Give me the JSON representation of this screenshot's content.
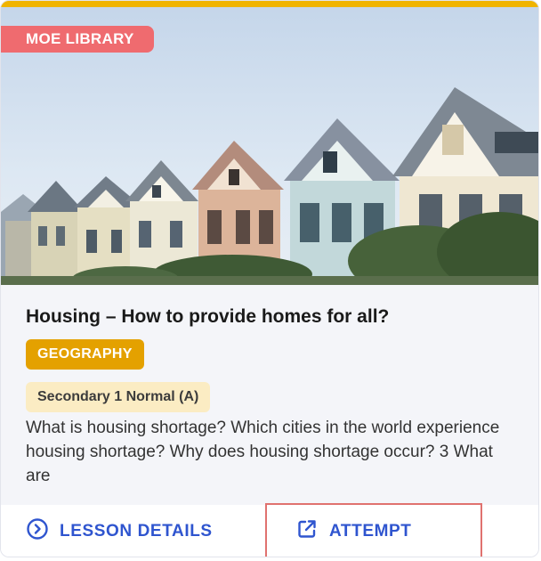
{
  "card": {
    "badge": "MOE LIBRARY",
    "title": "Housing – How to provide homes for all?",
    "subject": "GEOGRAPHY",
    "level": "Secondary 1 Normal (A)",
    "description": "What is housing shortage? Which cities in the world experience housing shortage? Why does housing shortage occur? 3 What are",
    "image_icon": "painted-ladies-houses-image"
  },
  "actions": {
    "lesson_details": {
      "label": "LESSON DETAILS",
      "icon": "chevron-right-circle-icon"
    },
    "attempt": {
      "label": "ATTEMPT",
      "icon": "external-link-icon"
    }
  },
  "colors": {
    "accent_bar": "#f0b400",
    "badge": "#ef6b6f",
    "subject_tag": "#e4a100",
    "level_tag": "#fbecc3",
    "action_text": "#2f55cf",
    "highlight_border": "#e0726f"
  }
}
